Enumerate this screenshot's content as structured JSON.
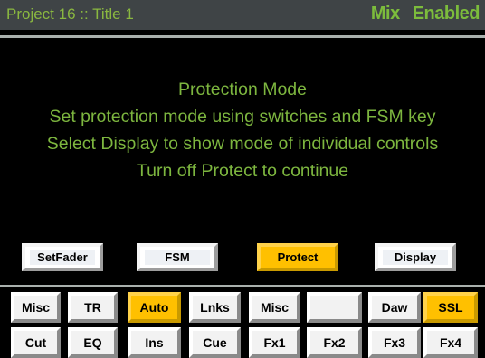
{
  "header": {
    "project_title": "Project 16  ::  Title 1",
    "mix_label": "Mix",
    "enabled_label": "Enabled"
  },
  "message": {
    "line1": "Protection Mode",
    "line2": "Set protection mode using switches and FSM key",
    "line3": "Select Display to show mode of individual controls",
    "line4": "Turn off Protect to continue"
  },
  "softkeys": [
    {
      "label": "SetFader",
      "active": false
    },
    {
      "label": "FSM",
      "active": false
    },
    {
      "label": "Protect",
      "active": true
    },
    {
      "label": "Display",
      "active": false
    }
  ],
  "row1": [
    {
      "label": "Misc",
      "active": false
    },
    {
      "label": "TR",
      "active": false
    },
    {
      "label": "Auto",
      "active": true
    },
    {
      "label": "Lnks",
      "active": false
    },
    {
      "label": "Misc",
      "active": false
    },
    {
      "label": "",
      "active": false
    },
    {
      "label": "Daw",
      "active": false
    },
    {
      "label": "SSL",
      "active": true
    }
  ],
  "row2": [
    {
      "label": "Cut",
      "active": false
    },
    {
      "label": "EQ",
      "active": false
    },
    {
      "label": "Ins",
      "active": false
    },
    {
      "label": "Cue",
      "active": false
    },
    {
      "label": "Fx1",
      "active": false
    },
    {
      "label": "Fx2",
      "active": false
    },
    {
      "label": "Fx3",
      "active": false
    },
    {
      "label": "Fx4",
      "active": false
    }
  ],
  "colors": {
    "text_green": "#7db63f",
    "active_amber": "#ffc000",
    "titlebar_bg": "#3f4446"
  }
}
